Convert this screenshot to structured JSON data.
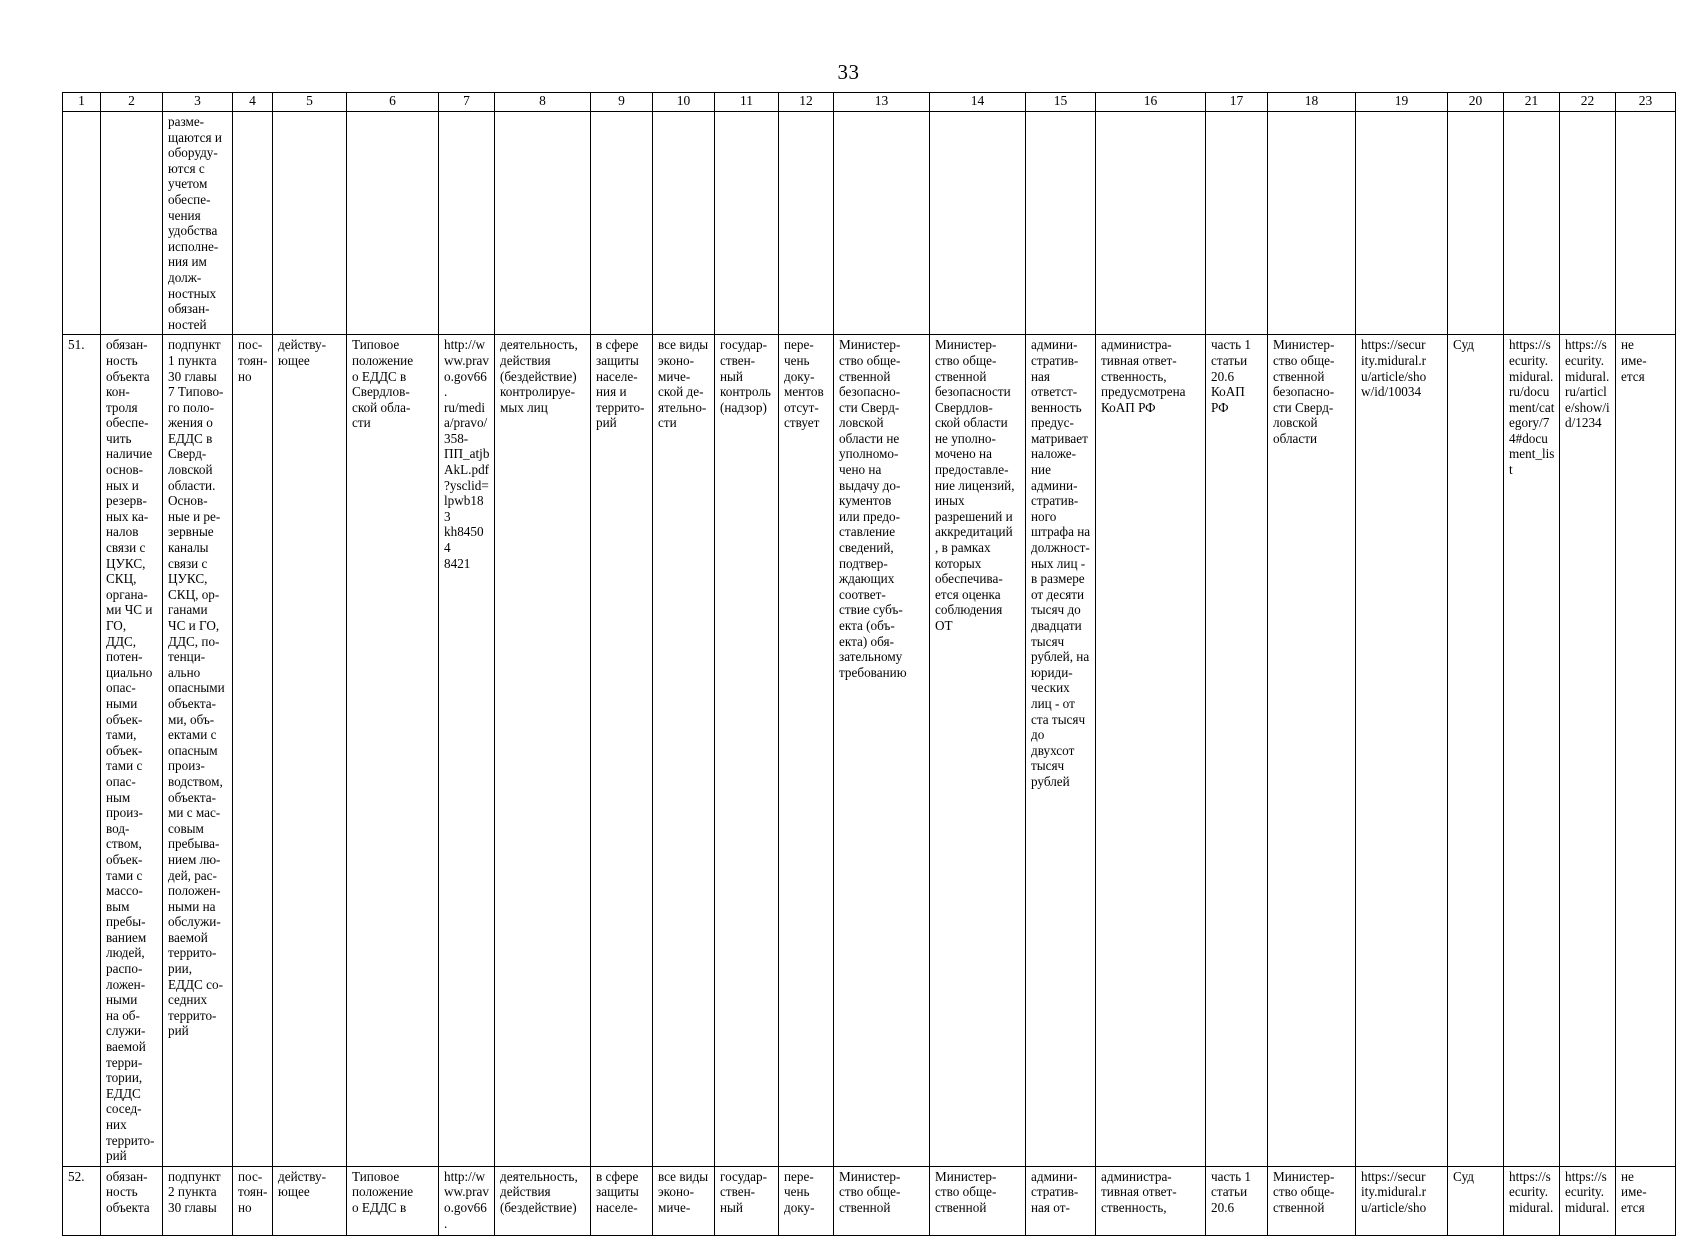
{
  "page": {
    "number": "33"
  },
  "table": {
    "column_numbers": [
      "1",
      "2",
      "3",
      "4",
      "5",
      "6",
      "7",
      "8",
      "9",
      "10",
      "11",
      "12",
      "13",
      "14",
      "15",
      "16",
      "17",
      "18",
      "19",
      "20",
      "21",
      "22",
      "23"
    ],
    "rows": [
      {
        "name": "continuation-row",
        "cells": [
          "",
          "",
          "разме-\nщаются и\nоборуду-\nются с\nучетом\nобеспе-\nчения\nудобства\nисполне-\nния им\nдолж-\nностных\nобязан-\nностей",
          "",
          "",
          "",
          "",
          "",
          "",
          "",
          "",
          "",
          "",
          "",
          "",
          "",
          "",
          "",
          "",
          "",
          "",
          "",
          ""
        ]
      },
      {
        "name": "row-51",
        "cells": [
          "51.",
          "обязан-\nность\nобъекта\nкон-\nтроля\nобеспе-\nчить\nналичие\nоснов-\nных и\nрезерв-\nных ка-\nналов\nсвязи с\nЦУКС,\nСКЦ,\nоргана-\nми ЧС и\nГО,\nДДС,\nпотен-\nциально\nопас-\nными\nобъек-\nтами,\nобъек-\nтами с\nопас-\nным\nпроиз-\nвод-\nством,\nобъек-\nтами с\nмассо-\nвым\nпребы-\nванием\nлюдей,\nраспо-\nложен-\nными\nна об-\nслужи-\nваемой\nтерри-\nтории,\nЕДДС\nсосед-\nних\nтеррито-\nрий",
          "подпункт\n1 пункта\n30 главы\n7 Типово-\nго поло-\nжения о\nЕДДС в\nСверд-\nловской\nобласти.\nОснов-\nные и ре-\nзервные\nканалы\nсвязи с\nЦУКС,\nСКЦ, ор-\nганами\nЧС и ГО,\nДДС, по-\nтенци-\nально\nопасными\nобъекта-\nми, объ-\nектами с\nопасным\nпроиз-\nводством,\nобъекта-\nми с мас-\nсовым\nпребыва-\nнием лю-\nдей, рас-\nположен-\nными на\nобслужи-\nваемой\nтеррито-\nрии,\nЕДДС со-\nседних\nтеррито-\nрий",
          "пос-\nтоян-\nно",
          "действу-\nющее",
          "Типовое\nположение\nо ЕДДС в\nСвердлов-\nской обла-\nсти",
          "http://w\nww.prav\no.gov66.\nru/medi\na/pravo/\n358-\nПП_atjb\nAkL.pdf\n?ysclid=\nlpwb183\nkh84504\n8421",
          "деятельность,\nдействия\n(бездействие)\nконтролируе-\nмых лиц",
          "в сфере\nзащиты\nнаселе-\nния и\nтеррито-\nрий",
          "все виды\nэконо-\nмиче-\nской де-\nятельно-\nсти",
          "государ-\nствен-\nный\nконтроль\n(надзор)",
          "пере-\nчень\nдоку-\nментов\nотсут-\nствует",
          "Министер-\nство обще-\nственной\nбезопасно-\nсти Сверд-\nловской\nобласти не\nуполномо-\nчено на\nвыдачу до-\nкументов\nили предо-\nставление\nсведений,\nподтвер-\nждающих\nсоответ-\nствие субъ-\nекта (объ-\nекта) обя-\nзательному\nтребованию",
          "Министер-\nство обще-\nственной\nбезопасности\nСвердлов-\nской области\nне уполно-\nмочено на\nпредоставле-\nние лицензий,\nиных\nразрешений и\nаккредитаций\n, в рамках\nкоторых\nобеспечива-\nется оценка\nсоблюдения\nОТ",
          "админи-\nстратив-\nная\nответст-\nвенность\nпредус-\nматривает\nналоже-\nние\nадмини-\nстратив-\nного\nштрафа на\nдолжност-\nных лиц -\nв размере\nот десяти\nтысяч до\nдвадцати\nтысяч\nрублей, на\nюриди-\nческих\nлиц - от\nста тысяч\nдо\nдвухсот\nтысяч\nрублей",
          "администра-\nтивная ответ-\nственность,\nпредусмотрена\nКоАП РФ",
          "часть 1\nстатьи\n20.6\nКоАП РФ",
          "Министер-\nство обще-\nственной\nбезопасно-\nсти Сверд-\nловской\nобласти",
          "https://secur\nity.midural.r\nu/article/sho\nw/id/10034",
          "Суд",
          "https://s\necurity.\nmidural.\nru/docu\nment/cat\negory/7\n4#docu\nment_lis\nt",
          "https://s\necurity.\nmidural.\nru/articl\ne/show/i\nd/1234",
          "не\nиме-\nется"
        ]
      },
      {
        "name": "row-52",
        "cells": [
          "52.",
          "обязан-\nность\nобъекта",
          "подпункт\n2 пункта\n30 главы",
          "пос-\nтоян-\nно",
          "действу-\nющее",
          "Типовое\nположение\nо ЕДДС в",
          "http://w\nww.prav\no.gov66.",
          "деятельность,\nдействия\n(бездействие)",
          "в сфере\nзащиты\nнаселе-",
          "все виды\nэконо-\nмиче-",
          "государ-\nствен-\nный",
          "пере-\nчень\nдоку-",
          "Министер-\nство обще-\nственной",
          "Министер-\nство обще-\nственной",
          "админи-\nстратив-\nная от-",
          "администра-\nтивная ответ-\nственность,",
          "часть 1\nстатьи\n20.6",
          "Министер-\nство обще-\nственной",
          "https://secur\nity.midural.r\nu/article/sho",
          "Суд",
          "https://s\necurity.\nmidural.",
          "https://s\necurity.\nmidural.",
          "не\nиме-\nется"
        ]
      }
    ]
  }
}
